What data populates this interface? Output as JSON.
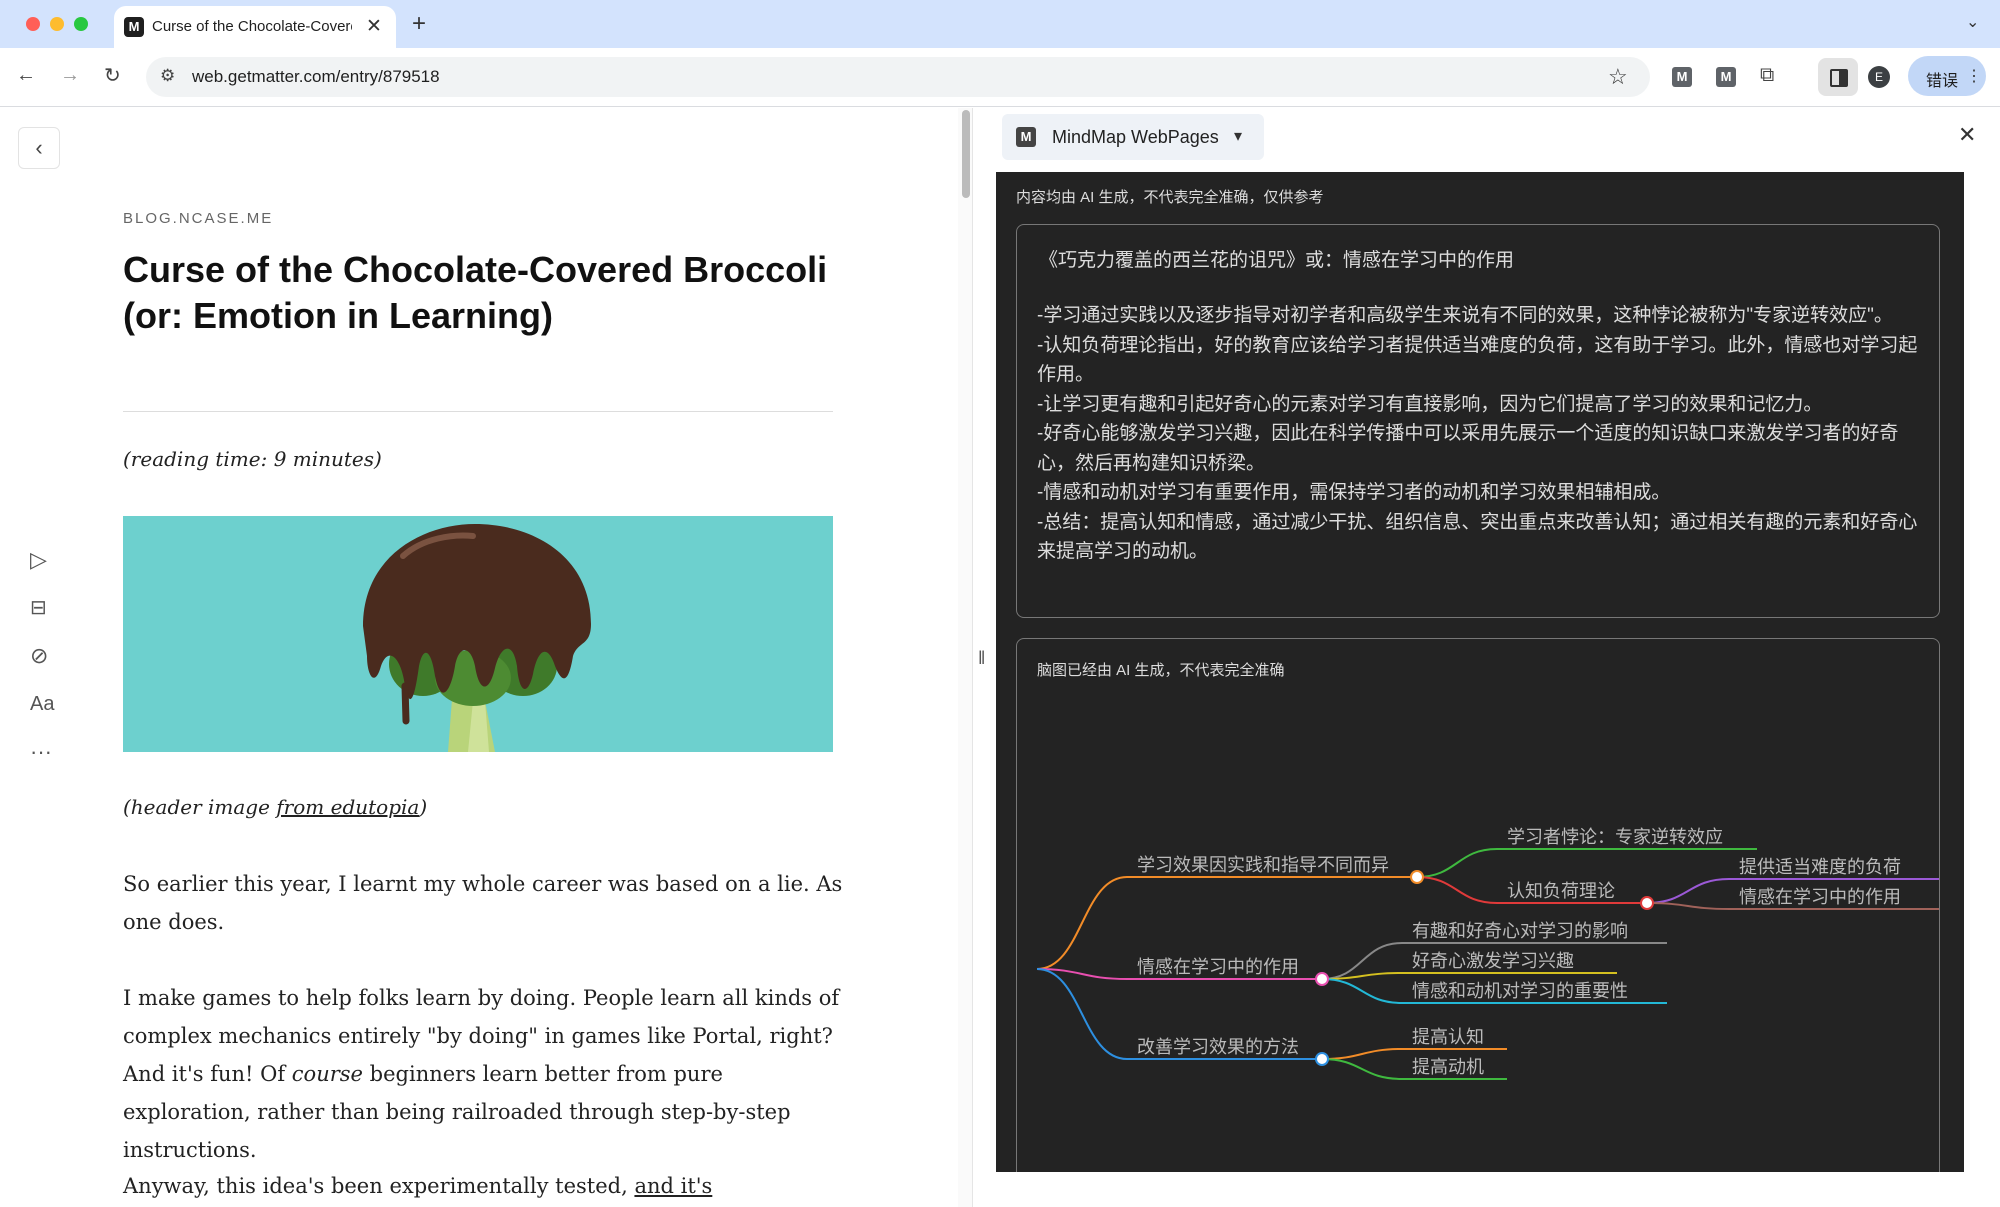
{
  "browser": {
    "tab_title": "Curse of the Chocolate-Covered Broccoli",
    "tab_favicon": "M",
    "url": "web.getmatter.com/entry/879518",
    "extension_badge_1": "M",
    "extension_badge_2": "M",
    "profile_initial": "E",
    "error_button": "错误",
    "icons": [
      "back-icon",
      "forward-icon",
      "reload-icon",
      "site-info-icon",
      "star-icon",
      "puzzle-icon",
      "sidepanel-icon",
      "chevron-down-icon"
    ]
  },
  "article": {
    "site": "BLOG.NCASE.ME",
    "title": "Curse of the Chocolate-Covered Broccoli (or: Emotion in Learning)",
    "reading_time": "(reading time: 9 minutes)",
    "caption_prefix": "(header image ",
    "caption_link": "from edutopia",
    "caption_suffix": ")",
    "p1": "So earlier this year, I learnt my whole career was based on a lie. As one does.",
    "p2_a": "I make games to help folks learn by doing. People learn all kinds of complex mechanics entirely \"by doing\" in games like Portal, right? And it's fun! Of ",
    "p2_em": "course",
    "p2_b": " beginners learn better from pure exploration, rather than being railroaded through step-by-step instructions.",
    "p3_a": "Anyway, this idea's been experimentally tested, ",
    "p3_link": "and it's replicatably",
    "font_icon_label": "Aa",
    "more_label": "···"
  },
  "panel": {
    "app_name": "MindMap WebPages",
    "app_icon": "M",
    "ai_notice": "内容均由 AI 生成，不代表完全准确，仅供参考",
    "summary_title": "《巧克力覆盖的西兰花的诅咒》或：情感在学习中的作用",
    "summary_lines": [
      "-学习通过实践以及逐步指导对初学者和高级学生来说有不同的效果，这种悖论被称为\"专家逆转效应\"。",
      "-认知负荷理论指出，好的教育应该给学习者提供适当难度的负荷，这有助于学习。此外，情感也对学习起作用。",
      "-让学习更有趣和引起好奇心的元素对学习有直接影响，因为它们提高了学习的效果和记忆力。",
      "-好奇心能够激发学习兴趣，因此在科学传播中可以采用先展示一个适度的知识缺口来激发学习者的好奇心，然后再构建知识桥梁。",
      "-情感和动机对学习有重要作用，需保持学习者的动机和学习效果相辅相成。",
      "-总结：提高认知和情感，通过减少干扰、组织信息、突出重点来改善认知；通过相关有趣的元素和好奇心来提高学习的动机。"
    ],
    "map_notice": "脑图已经由 AI 生成，不代表完全准确",
    "mindmap": {
      "branches": [
        {
          "label": "学习效果因实践和指导不同而异",
          "color": "#f28c28",
          "children": [
            {
              "label": "学习者悖论：专家逆转效应",
              "color": "#3fb93f"
            },
            {
              "label": "认知负荷理论",
              "color": "#e03a3a",
              "children": [
                {
                  "label": "提供适当难度的负荷",
                  "color": "#9b59d6"
                },
                {
                  "label": "情感在学习中的作用",
                  "color": "#a0625a"
                }
              ]
            }
          ]
        },
        {
          "label": "情感在学习中的作用",
          "color": "#e84fb0",
          "children": [
            {
              "label": "有趣和好奇心对学习的影响",
              "color": "#888888"
            },
            {
              "label": "好奇心激发学习兴趣",
              "color": "#d4c020"
            },
            {
              "label": "情感和动机对学习的重要性",
              "color": "#23b8d6"
            }
          ]
        },
        {
          "label": "改善学习效果的方法",
          "color": "#2d8fe0",
          "children": [
            {
              "label": "提高认知",
              "color": "#f28c28"
            },
            {
              "label": "提高动机",
              "color": "#3fb93f"
            }
          ]
        }
      ]
    }
  }
}
